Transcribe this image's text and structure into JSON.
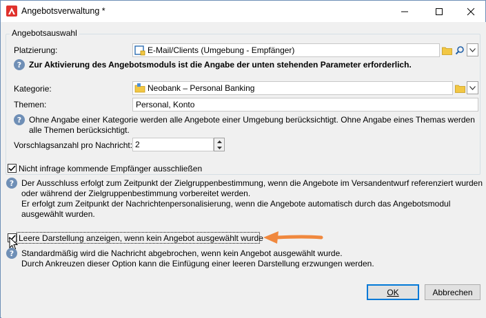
{
  "window": {
    "title": "Angebotsverwaltung *",
    "minimize_glyph": "—",
    "maximize_glyph": "☐",
    "close_glyph": "✕"
  },
  "group": {
    "legend": "Angebotsauswahl"
  },
  "placement": {
    "label": "Platzierung:",
    "value": "E-Mail/Clients (Umgebung - Empfänger)"
  },
  "activation_note": "Zur Aktivierung des Angebotsmoduls ist die Angabe der unten stehenden Parameter erforderlich.",
  "category": {
    "label": "Kategorie:",
    "value": "Neobank – Personal Banking"
  },
  "themes": {
    "label": "Themen:",
    "value": "Personal, Konto"
  },
  "category_note_line1": "Ohne Angabe einer Kategorie werden alle Angebote einer Umgebung berücksichtigt. Ohne Angabe eines Themas werden",
  "category_note_line2": "alle Themen berücksichtigt.",
  "proposals": {
    "label": "Vorschlagsanzahl pro Nachricht:",
    "value": "2"
  },
  "exclude": {
    "label": "Nicht infrage kommende Empfänger ausschließen",
    "checked": true,
    "note_line1": "Der Ausschluss erfolgt zum Zeitpunkt der Zielgruppenbestimmung, wenn die Angebote im Versandentwurf referenziert wurden",
    "note_line2": "oder während der Zielgruppenbestimmung vorbereitet werden.",
    "note_line3": "Er erfolgt zum Zeitpunkt der Nachrichtenpersonalisierung, wenn die Angebote automatisch durch das Angebotsmodul",
    "note_line4": "ausgewählt wurden."
  },
  "empty_rendering": {
    "label": "Leere Darstellung anzeigen, wenn kein Angebot ausgewählt wurde",
    "checked": true,
    "note_line1": "Standardmäßig wird die Nachricht abgebrochen, wenn kein Angebot ausgewählt wurde.",
    "note_line2": "Durch Ankreuzen dieser Option kann die Einfügung einer leeren Darstellung erzwungen werden."
  },
  "buttons": {
    "ok": "OK",
    "cancel": "Abbrechen"
  },
  "colors": {
    "accent": "#0078d7",
    "annotation_arrow": "#f0883e",
    "info_icon": "#6f8fb6",
    "folder": "#f2c744",
    "app_icon": "#e0322d"
  },
  "icons": {
    "app": "adobe-campaign-icon",
    "placement": "environment-icon",
    "folder": "folder-icon",
    "search": "search-icon",
    "dropdown": "chevron-down-icon",
    "info": "info-icon",
    "cursor": "mouse-cursor-icon"
  }
}
